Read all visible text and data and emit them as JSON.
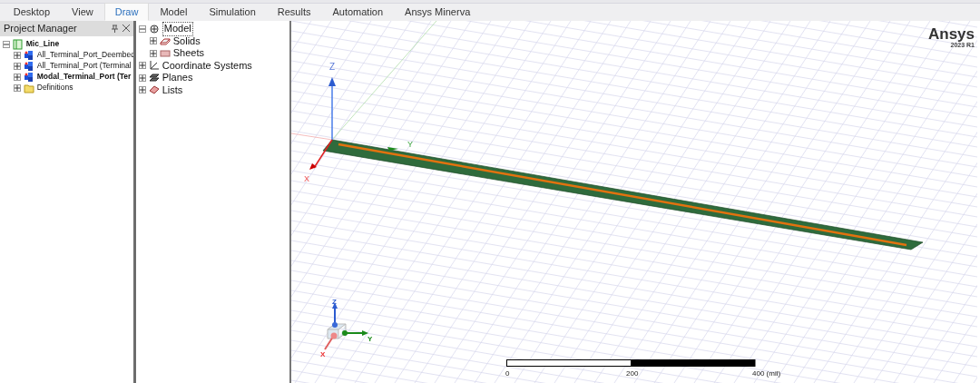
{
  "tabs": [
    {
      "label": "Desktop",
      "selected": false
    },
    {
      "label": "View",
      "selected": false
    },
    {
      "label": "Draw",
      "selected": true
    },
    {
      "label": "Model",
      "selected": false
    },
    {
      "label": "Simulation",
      "selected": false
    },
    {
      "label": "Results",
      "selected": false
    },
    {
      "label": "Automation",
      "selected": false
    },
    {
      "label": "Ansys Minerva",
      "selected": false
    }
  ],
  "project_manager": {
    "title": "Project Manager",
    "tree": [
      {
        "label": "Mic_Line",
        "kind": "project",
        "bold": true,
        "expanded": true,
        "children": [
          {
            "label": "All_Terminal_Port_Deembed",
            "kind": "design",
            "bold": false,
            "expanded": false
          },
          {
            "label": "All_Terminal_Port (Terminal",
            "kind": "design",
            "bold": false,
            "expanded": false
          },
          {
            "label": "Modal_Terminal_Port (Ter",
            "kind": "design",
            "bold": true,
            "expanded": false
          },
          {
            "label": "Definitions",
            "kind": "folder",
            "bold": false,
            "expanded": false
          }
        ]
      }
    ]
  },
  "model_tree": [
    {
      "label": "Model",
      "kind": "model",
      "expanded": true,
      "selected": true,
      "children": [
        {
          "label": "Solids",
          "kind": "solid",
          "expanded": false,
          "selected": false
        },
        {
          "label": "Sheets",
          "kind": "sheet",
          "expanded": false,
          "selected": false
        }
      ]
    },
    {
      "label": "Coordinate Systems",
      "kind": "coords",
      "expanded": false,
      "selected": false
    },
    {
      "label": "Planes",
      "kind": "planes",
      "expanded": false,
      "selected": false
    },
    {
      "label": "Lists",
      "kind": "lists",
      "expanded": false,
      "selected": false
    }
  ],
  "viewport": {
    "logo": "Ansys",
    "version": "2023 R1",
    "axes": {
      "z": "Z",
      "y": "Y",
      "x": "X"
    },
    "triad": {
      "z": "Z",
      "y": "Y",
      "x": "X"
    },
    "scale": {
      "labels": [
        "0",
        "200",
        "400 (mil)"
      ]
    }
  }
}
